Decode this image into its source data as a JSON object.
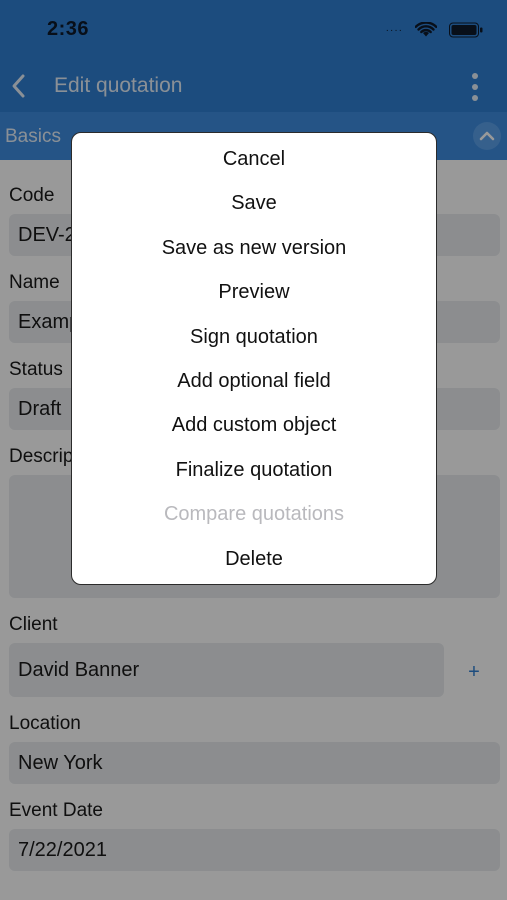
{
  "status_bar": {
    "time": "2:36",
    "signal_icon": "signal-dots-icon",
    "wifi_icon": "wifi-icon",
    "battery_icon": "battery-icon"
  },
  "nav": {
    "back_icon": "chevron-left-icon",
    "title": "Edit quotation",
    "more_icon": "vertical-ellipsis-icon"
  },
  "section": {
    "title": "Basics",
    "collapse_icon": "chevron-up-icon"
  },
  "form": {
    "code": {
      "label": "Code",
      "value": "DEV-2"
    },
    "name": {
      "label": "Name",
      "value": "Examp"
    },
    "status": {
      "label": "Status",
      "value": "Draft"
    },
    "description": {
      "label": "Descrip",
      "value": ""
    },
    "client": {
      "label": "Client",
      "value": "David Banner",
      "add_label": "+"
    },
    "location": {
      "label": "Location",
      "value": "New York"
    },
    "event_date": {
      "label": "Event Date",
      "value": "7/22/2021"
    }
  },
  "action_sheet": {
    "items": [
      {
        "label": "Cancel",
        "enabled": true
      },
      {
        "label": "Save",
        "enabled": true
      },
      {
        "label": "Save as new version",
        "enabled": true
      },
      {
        "label": "Preview",
        "enabled": true
      },
      {
        "label": "Sign quotation",
        "enabled": true
      },
      {
        "label": "Add optional field",
        "enabled": true
      },
      {
        "label": "Add custom object",
        "enabled": true
      },
      {
        "label": "Finalize quotation",
        "enabled": true
      },
      {
        "label": "Compare quotations",
        "enabled": false
      },
      {
        "label": "Delete",
        "enabled": true
      }
    ]
  },
  "colors": {
    "primary": "#2f7fd3",
    "section_header": "#3e8de0",
    "disabled_text": "#b9b9bd"
  }
}
